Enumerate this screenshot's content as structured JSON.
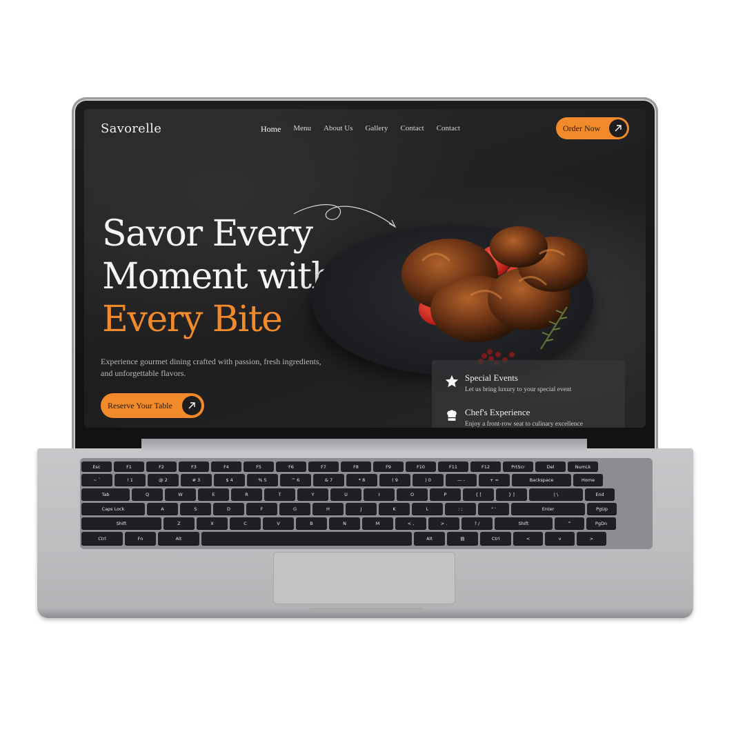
{
  "site": {
    "logo": "Savorelle",
    "nav": [
      {
        "label": "Home",
        "active": true
      },
      {
        "label": "Menu",
        "active": false
      },
      {
        "label": "About Us",
        "active": false
      },
      {
        "label": "Gallery",
        "active": false
      },
      {
        "label": "Contact",
        "active": false
      },
      {
        "label": "Contact",
        "active": false
      }
    ],
    "order_button": "Order Now",
    "hero": {
      "line1": "Savor Every",
      "line2": "Moment with",
      "accent": "Every Bite",
      "subtitle": "Experience gourmet dining crafted with passion, fresh ingredients, and unforgettable flavors.",
      "cta": "Reserve Your Table"
    },
    "features": [
      {
        "title": "Special Events",
        "desc": "Let us bring luxury to your special event",
        "icon": "star-icon"
      },
      {
        "title": "Chef's Experience",
        "desc": "Enjoy a front-row seat to culinary excellence",
        "icon": "chef-hat-icon"
      }
    ]
  },
  "colors": {
    "accent": "#f08a2a",
    "screen_bg": "#262628",
    "laptop_body": "#c3c3c6",
    "key": "#1f2023"
  },
  "keyboard": {
    "rows": [
      [
        "Esc",
        "F1",
        "F2",
        "F3",
        "F4",
        "F5",
        "F6",
        "F7",
        "F8",
        "F9",
        "F10",
        "F11",
        "F12",
        "PrtScr",
        "Del",
        "NumLk"
      ],
      [
        "~ `",
        "! 1",
        "@ 2",
        "# 3",
        "$ 4",
        "% 5",
        "^ 6",
        "& 7",
        "* 8",
        "( 9",
        ") 0",
        "— -",
        "+ =",
        "Backspace",
        "Home"
      ],
      [
        "Tab",
        "Q",
        "W",
        "E",
        "R",
        "T",
        "Y",
        "U",
        "I",
        "O",
        "P",
        "{ [",
        "} ]",
        "| \\",
        "End"
      ],
      [
        "Caps Lock",
        "A",
        "S",
        "D",
        "F",
        "G",
        "H",
        "J",
        "K",
        "L",
        ": ;",
        "\" '",
        "Enter",
        "PgUp"
      ],
      [
        "Shift",
        "Z",
        "X",
        "C",
        "V",
        "B",
        "N",
        "M",
        "< ,",
        "> .",
        "? /",
        "Shift",
        "^",
        "PgDn"
      ],
      [
        "Ctrl",
        "Fn",
        "Alt",
        "",
        "Alt",
        "▤",
        "Ctrl",
        "<",
        "v",
        ">"
      ]
    ]
  }
}
